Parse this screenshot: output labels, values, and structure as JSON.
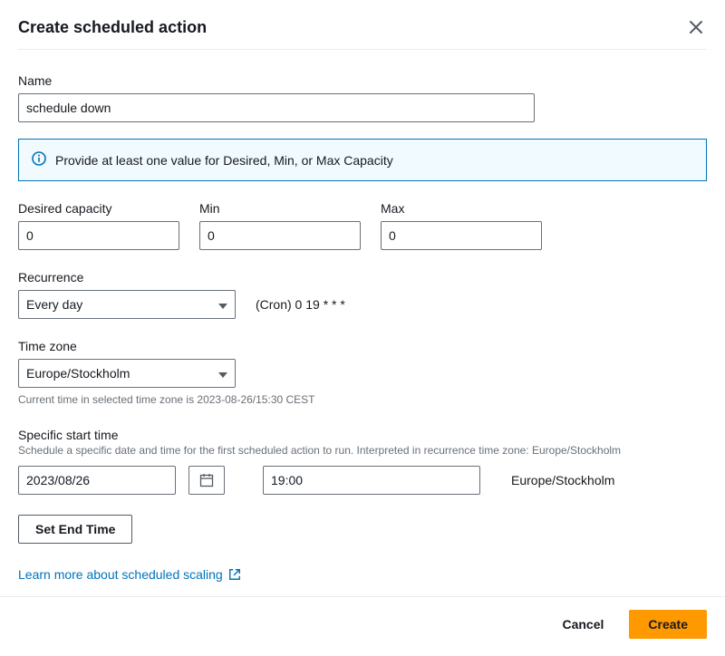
{
  "header": {
    "title": "Create scheduled action"
  },
  "name": {
    "label": "Name",
    "value": "schedule down"
  },
  "banner": {
    "message": "Provide at least one value for Desired, Min, or Max Capacity"
  },
  "capacity": {
    "desired": {
      "label": "Desired capacity",
      "value": "0"
    },
    "min": {
      "label": "Min",
      "value": "0"
    },
    "max": {
      "label": "Max",
      "value": "0"
    }
  },
  "recurrence": {
    "label": "Recurrence",
    "selected": "Every day",
    "cron": "(Cron) 0 19 * * *"
  },
  "timezone": {
    "label": "Time zone",
    "selected": "Europe/Stockholm",
    "hint": "Current time in selected time zone is 2023-08-26/15:30 CEST"
  },
  "start": {
    "label": "Specific start time",
    "sub": "Schedule a specific date and time for the first scheduled action to run. Interpreted in recurrence time zone: Europe/Stockholm",
    "date": "2023/08/26",
    "time": "19:00",
    "tz": "Europe/Stockholm"
  },
  "end_button": "Set End Time",
  "learn_link": "Learn more about scheduled scaling",
  "footer": {
    "cancel": "Cancel",
    "create": "Create"
  }
}
